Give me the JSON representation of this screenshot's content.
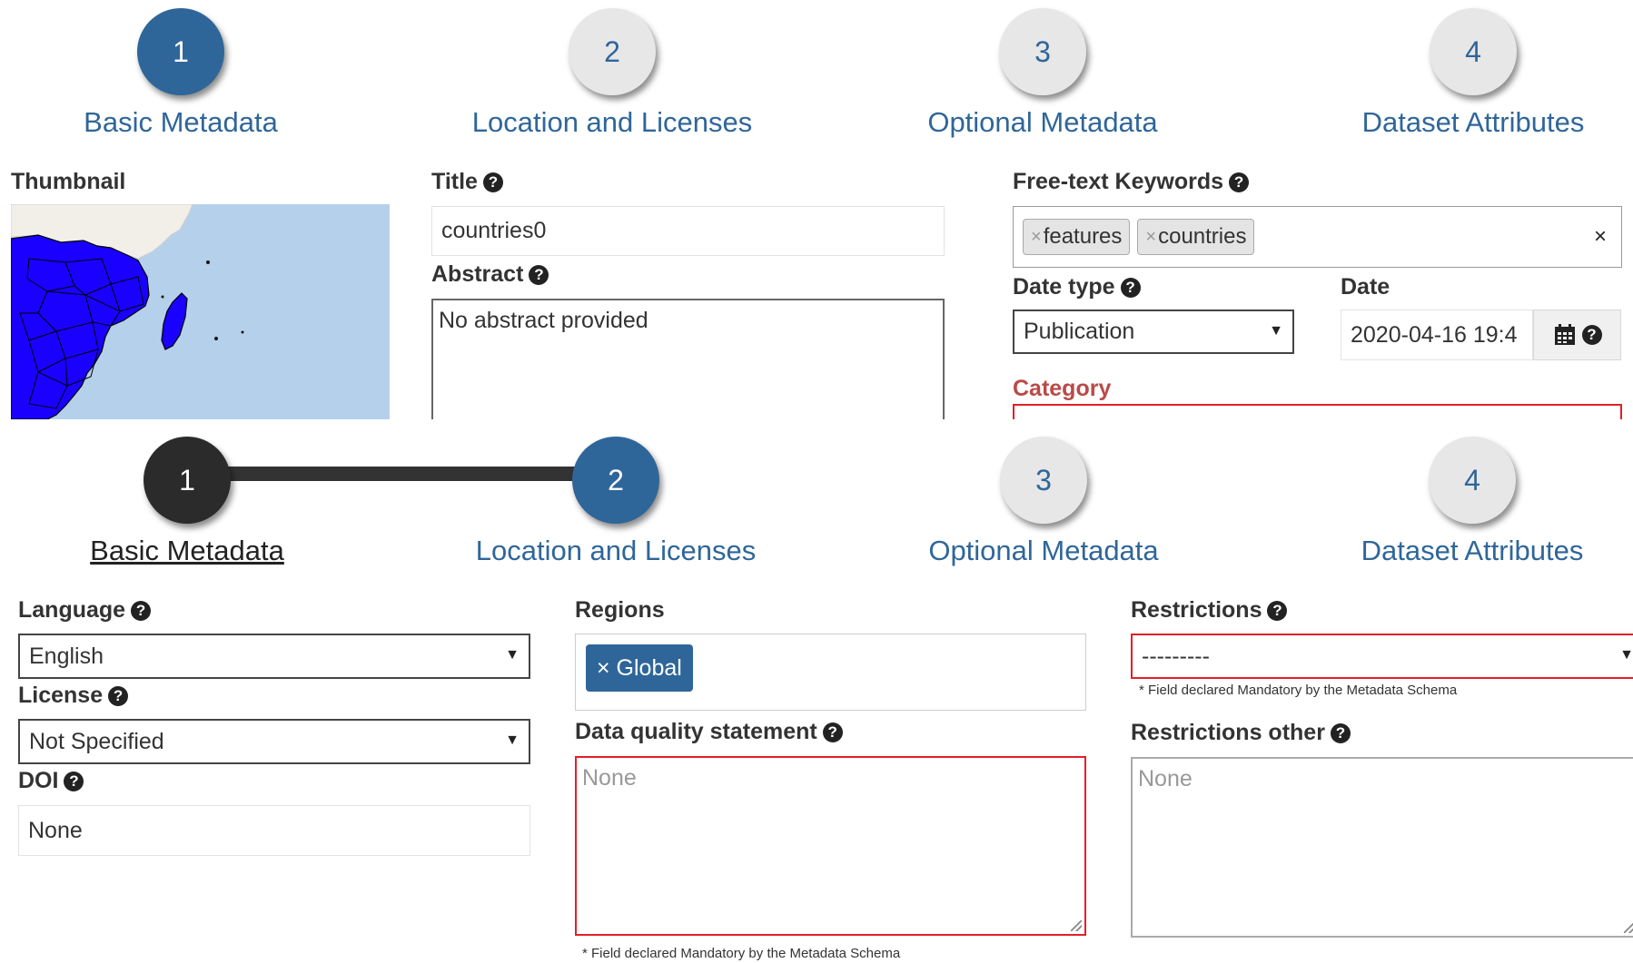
{
  "wizard_top": {
    "steps": [
      {
        "number": "1",
        "label": "Basic Metadata",
        "state": "active"
      },
      {
        "number": "2",
        "label": "Location and Licenses",
        "state": "pending"
      },
      {
        "number": "3",
        "label": "Optional Metadata",
        "state": "pending"
      },
      {
        "number": "4",
        "label": "Dataset Attributes",
        "state": "pending"
      }
    ]
  },
  "basic": {
    "thumbnail_label": "Thumbnail",
    "title_label": "Title",
    "title_value": "countries0",
    "abstract_label": "Abstract",
    "abstract_value": "No abstract provided",
    "keywords_label": "Free-text Keywords",
    "keywords": [
      "features",
      "countries"
    ],
    "keywords_clear": "×",
    "tag_remove": "×",
    "date_type_label": "Date type",
    "date_type_value": "Publication",
    "date_label": "Date",
    "date_value": "2020-04-16 19:4",
    "category_label": "Category"
  },
  "wizard_bottom": {
    "steps": [
      {
        "number": "1",
        "label": "Basic Metadata",
        "state": "done"
      },
      {
        "number": "2",
        "label": "Location and Licenses",
        "state": "active"
      },
      {
        "number": "3",
        "label": "Optional Metadata",
        "state": "pending"
      },
      {
        "number": "4",
        "label": "Dataset Attributes",
        "state": "pending"
      }
    ]
  },
  "location": {
    "language_label": "Language",
    "language_value": "English",
    "license_label": "License",
    "license_value": "Not Specified",
    "doi_label": "DOI",
    "doi_value": "None",
    "regions_label": "Regions",
    "region_chip": "× Global",
    "dq_label": "Data quality statement",
    "dq_placeholder": "None",
    "dq_note": "* Field declared Mandatory by the Metadata Schema",
    "restrictions_label": "Restrictions",
    "restrictions_value": "---------",
    "restrictions_note": "* Field declared Mandatory by the Metadata Schema",
    "restrictions_other_label": "Restrictions other",
    "restrictions_other_placeholder": "None"
  },
  "colors": {
    "primary": "#2f6699",
    "done": "#2b2b2b",
    "pending": "#e7e7e7",
    "error": "#e31f26",
    "error_text": "#b94a48",
    "map_water": "#b5d0ea",
    "map_land": "#f2efe9",
    "map_feature": "#1a00ff"
  },
  "icons": {
    "help": "question-circle-icon",
    "calendar": "calendar-icon",
    "caret": "caret-down-icon"
  }
}
